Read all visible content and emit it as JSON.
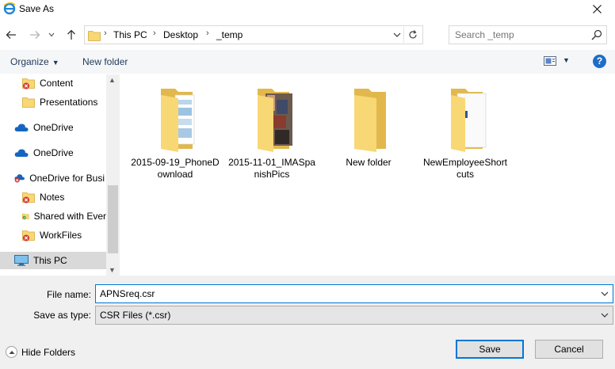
{
  "window": {
    "title": "Save As"
  },
  "address": {
    "crumbs": [
      "This PC",
      "Desktop",
      "_temp"
    ]
  },
  "search": {
    "placeholder": "Search _temp"
  },
  "toolbar": {
    "organize_label": "Organize",
    "new_folder_label": "New folder",
    "help_label": "?"
  },
  "sidebar": {
    "items": [
      {
        "label": "Content",
        "icon": "folder-error-icon"
      },
      {
        "label": "Presentations",
        "icon": "folder-icon"
      },
      {
        "label": "OneDrive",
        "icon": "onedrive-icon"
      },
      {
        "label": "OneDrive",
        "icon": "onedrive-icon"
      },
      {
        "label": "OneDrive for Busi",
        "icon": "onedrive-error-icon"
      },
      {
        "label": "Notes",
        "icon": "folder-error-icon"
      },
      {
        "label": "Shared with Ever",
        "icon": "folder-synced-icon"
      },
      {
        "label": "WorkFiles",
        "icon": "folder-error-icon"
      },
      {
        "label": "This PC",
        "icon": "pc-icon",
        "selected": true
      }
    ]
  },
  "content": {
    "items": [
      {
        "name": "2015-09-19_PhoneDownload",
        "icon": "folder-with-documents-icon"
      },
      {
        "name": "2015-11-01_IMASpanishPics",
        "icon": "folder-with-photos-icon"
      },
      {
        "name": "New folder",
        "icon": "empty-folder-icon"
      },
      {
        "name": "NewEmployeeShortcuts",
        "icon": "folder-with-document-icon"
      }
    ]
  },
  "save": {
    "filename_label": "File name:",
    "filename_value": "APNSreq.csr",
    "type_label": "Save as type:",
    "type_value": "CSR Files (*.csr)"
  },
  "footer": {
    "hide_folders_label": "Hide Folders",
    "save_label": "Save",
    "cancel_label": "Cancel"
  },
  "colors": {
    "accent": "#0078d7",
    "folder": "#f8d775",
    "toolbar": "#f5f6f7",
    "selection": "#d9d9d9"
  }
}
